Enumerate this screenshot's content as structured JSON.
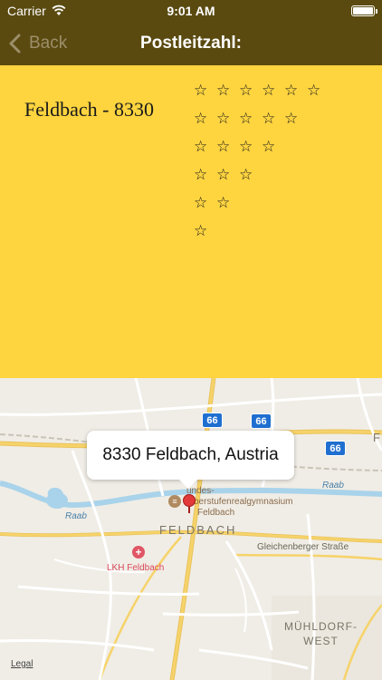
{
  "status_bar": {
    "carrier": "Carrier",
    "time": "9:01 AM",
    "battery_level": 1.0
  },
  "nav": {
    "back_label": "Back",
    "title": "Postleitzahl:"
  },
  "content": {
    "place_label": "Feldbach - 8330",
    "star_glyph": "☆",
    "star_rows": [
      6,
      5,
      4,
      3,
      2,
      1
    ]
  },
  "map": {
    "callout_text": "8330 Feldbach, Austria",
    "road_shields": [
      "66",
      "66",
      "66"
    ],
    "labels": {
      "river_1": "Raab",
      "river_2": "Raab",
      "street": "Gleichenberger Straße",
      "school_line_1": "undes-",
      "school_line_2": "berstufenrealgymnasium",
      "school_line_3": "Feldbach",
      "city": "FELDBACH",
      "hospital": "LKH Feldbach",
      "district_line_1": "MÜHLDORF-",
      "district_line_2": "WEST",
      "edge_letter": "F"
    },
    "legal": "Legal"
  },
  "colors": {
    "nav_bg": "#5a4a10",
    "content_bg": "#fed43f",
    "map_bg": "#f0ede6",
    "river": "#a9d3ea",
    "road_major": "#f6d36a",
    "pin": "#e23a3a",
    "shield": "#1f6fd0"
  }
}
